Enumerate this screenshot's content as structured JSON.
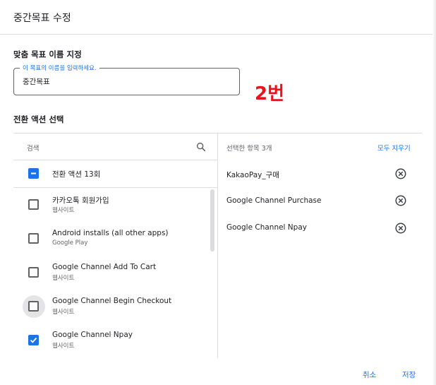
{
  "dialog": {
    "title": "중간목표 수정"
  },
  "goal_name": {
    "section_label": "맞춤 목표 이름 지정",
    "field_legend": "이 목표의 이름을 입력하세요.",
    "value": "중간목표"
  },
  "annotation_text": "2번",
  "conversion": {
    "section_label": "전환 액션 선택",
    "search_placeholder": "검색",
    "all_label": "전환 액션 13회",
    "items": [
      {
        "title": "카카오톡 회원가입",
        "subtitle": "웹사이트",
        "checked": false
      },
      {
        "title": "Android installs (all other apps)",
        "subtitle": "Google Play",
        "checked": false
      },
      {
        "title": "Google Channel Add To Cart",
        "subtitle": "웹사이트",
        "checked": false
      },
      {
        "title": "Google Channel Begin Checkout",
        "subtitle": "웹사이트",
        "checked": false,
        "hovered": true
      },
      {
        "title": "Google Channel Npay",
        "subtitle": "웹사이트",
        "checked": true
      }
    ]
  },
  "selected": {
    "header": "선택한 항목 3개",
    "clear_all": "모두 지우기",
    "items": [
      "KakaoPay_구매",
      "Google Channel Purchase",
      "Google Channel Npay"
    ]
  },
  "footer": {
    "cancel_label": "취소",
    "save_label": "저장"
  },
  "colors": {
    "accent": "#1a73e8",
    "annotation": "#e8141a"
  },
  "icons": {
    "search": "search-icon",
    "remove": "close-circle-icon",
    "indeterminate": "indeterminate-checkbox-icon",
    "check": "check-icon"
  }
}
